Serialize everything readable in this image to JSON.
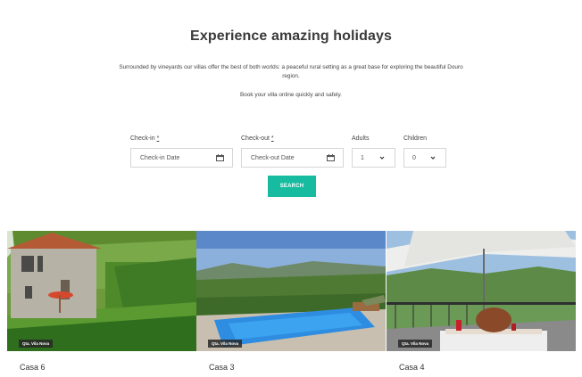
{
  "hero": {
    "title": "Experience amazing holidays",
    "description": "Surrounded by vineyards our villas offer the best of both worlds: a peaceful rural setting as a great base for exploring the beautiful Douro region.",
    "subtitle": "Book your villa online quickly and safely."
  },
  "booking": {
    "checkin_label": "Check-in",
    "checkin_required": "*",
    "checkin_placeholder": "Check-in Date",
    "checkout_label": "Check-out",
    "checkout_required": "*",
    "checkout_placeholder": "Check-out Date",
    "adults_label": "Adults",
    "adults_value": "1",
    "children_label": "Children",
    "children_value": "0",
    "search_label": "SEARCH"
  },
  "villas": [
    {
      "name": "Casa 6",
      "tag": "Qta. Vila Nova"
    },
    {
      "name": "Casa 3",
      "tag": "Qta. Vila Nova"
    },
    {
      "name": "Casa 4",
      "tag": "Qta. Vila Nova"
    }
  ],
  "colors": {
    "accent": "#17bca0",
    "text": "#3a3a3a",
    "border": "#d6d6d6"
  },
  "icons": {
    "date": "calendar-icon",
    "select": "chevron-down-icon"
  }
}
